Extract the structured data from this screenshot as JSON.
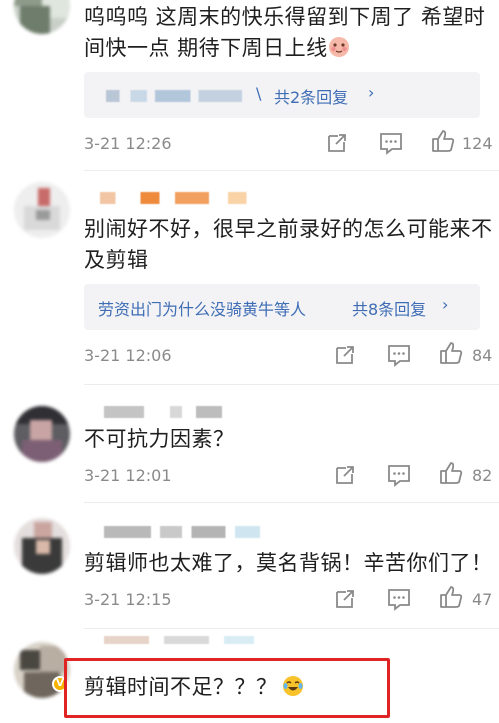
{
  "comments": [
    {
      "text_lines": [
        "呜呜呜 这周末的快乐得留到下周了 希望时",
        "间快一点 期待下周日上线"
      ],
      "reply": {
        "names": "",
        "summary": "共2条回复",
        "chevron": "›"
      },
      "time": "3-21 12:26",
      "likes": "124"
    },
    {
      "text_lines": [
        "别闹好不好，很早之前录好的怎么可能来不",
        "及剪辑"
      ],
      "reply": {
        "names": "劳资出门为什么没骑黄牛等人",
        "summary": "共8条回复",
        "chevron": "›"
      },
      "time": "3-21 12:06",
      "likes": "84"
    },
    {
      "text_lines": [
        "不可抗力因素？"
      ],
      "time": "3-21 12:01",
      "likes": "82"
    },
    {
      "text_lines": [
        "剪辑师也太难了，莫名背锅！辛苦你们了！"
      ],
      "time": "3-21 12:15",
      "likes": "47"
    },
    {
      "text_lines": [
        "剪辑时间不足？？？"
      ],
      "badge": "V"
    }
  ],
  "colors": {
    "link": "#3e6db5",
    "meta": "#8a8a8a",
    "highlight_border": "#e02424",
    "badge": "#f5b400"
  },
  "icons": [
    "share-icon",
    "comment-icon",
    "like-icon",
    "cry-laugh-emoji",
    "blush-emoji"
  ]
}
